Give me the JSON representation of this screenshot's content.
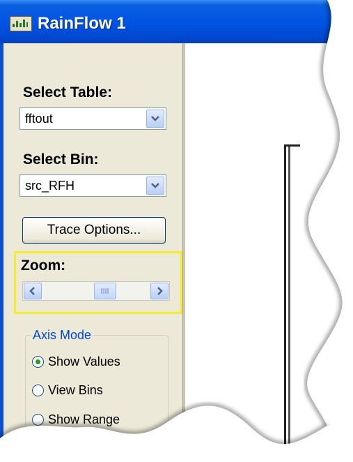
{
  "window": {
    "title": "RainFlow 1"
  },
  "panel": {
    "select_table": {
      "label": "Select Table:",
      "value": "fftout"
    },
    "select_bin": {
      "label": "Select Bin:",
      "value": "src_RFH"
    },
    "trace_options_button": "Trace Options...",
    "zoom": {
      "label": "Zoom:"
    },
    "axis_mode": {
      "title": "Axis Mode",
      "options": [
        {
          "label": "Show Values",
          "selected": true
        },
        {
          "label": "View Bins",
          "selected": false
        },
        {
          "label": "Show Range",
          "selected": false
        }
      ]
    }
  },
  "colors": {
    "titlebar": "#0054e3",
    "group_title": "#0046d5",
    "highlight": "#f2ee2e"
  }
}
